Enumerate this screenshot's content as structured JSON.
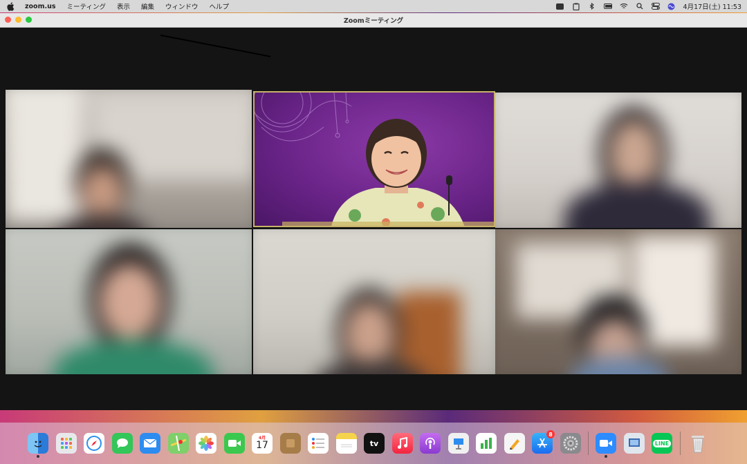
{
  "menubar": {
    "app_name": "zoom.us",
    "menus": [
      "ミーティング",
      "表示",
      "編集",
      "ウィンドウ",
      "ヘルプ"
    ],
    "datetime": "4月17日(土)  11:53"
  },
  "window": {
    "title": "Zoomミーティング"
  },
  "dock": {
    "calendar_month": "4月",
    "calendar_day": "17",
    "appstore_badge": "8",
    "line_label": "LINE",
    "appletv_label": "tv"
  },
  "colors": {
    "speaker_border": "#c7b36a",
    "speaker_background": "#6a2488"
  }
}
